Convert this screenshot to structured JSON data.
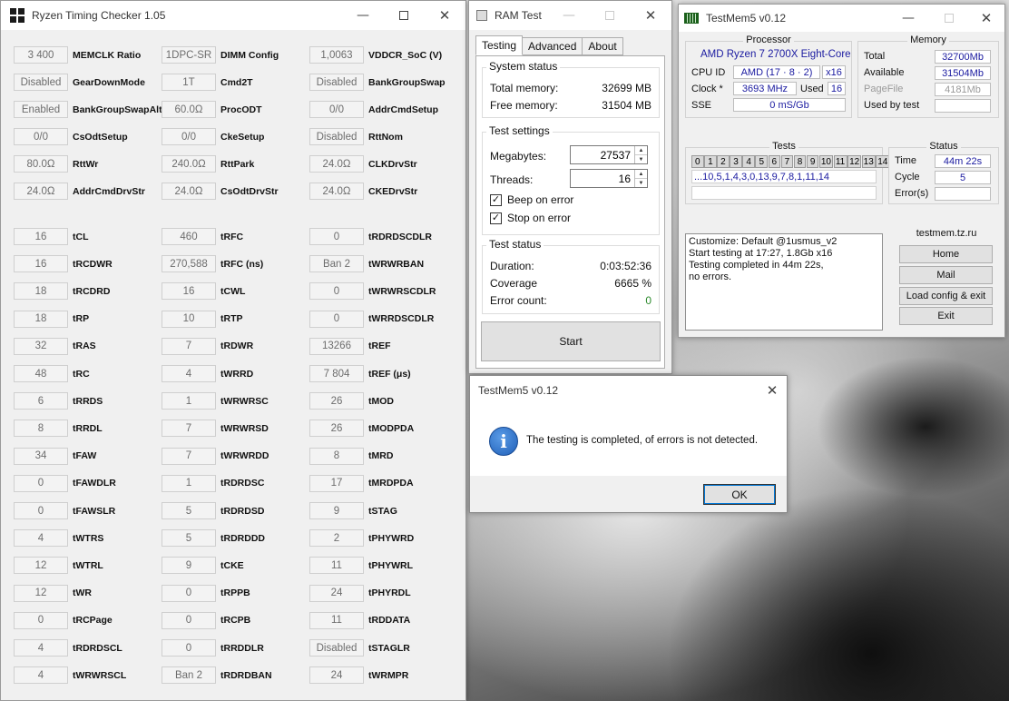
{
  "rtc": {
    "title": "Ryzen Timing Checker 1.05",
    "col1": [
      {
        "label": "MEMCLK Ratio",
        "value": "3 400"
      },
      {
        "label": "GearDownMode",
        "value": "Disabled"
      },
      {
        "label": "BankGroupSwapAlt",
        "value": "Enabled"
      },
      {
        "label": "CsOdtSetup",
        "value": "0/0"
      },
      {
        "label": "RttWr",
        "value": "80.0Ω"
      },
      {
        "label": "AddrCmdDrvStr",
        "value": "24.0Ω"
      },
      {
        "label": "tCL",
        "value": "16"
      },
      {
        "label": "tRCDWR",
        "value": "16"
      },
      {
        "label": "tRCDRD",
        "value": "18"
      },
      {
        "label": "tRP",
        "value": "18"
      },
      {
        "label": "tRAS",
        "value": "32"
      },
      {
        "label": "tRC",
        "value": "48"
      },
      {
        "label": "tRRDS",
        "value": "6"
      },
      {
        "label": "tRRDL",
        "value": "8"
      },
      {
        "label": "tFAW",
        "value": "34"
      },
      {
        "label": "tFAWDLR",
        "value": "0"
      },
      {
        "label": "tFAWSLR",
        "value": "0"
      },
      {
        "label": "tWTRS",
        "value": "4"
      },
      {
        "label": "tWTRL",
        "value": "12"
      },
      {
        "label": "tWR",
        "value": "12"
      },
      {
        "label": "tRCPage",
        "value": "0"
      },
      {
        "label": "tRDRDSCL",
        "value": "4"
      },
      {
        "label": "tWRWRSCL",
        "value": "4"
      }
    ],
    "col2": [
      {
        "label": "DIMM Config",
        "value": "1DPC-SR"
      },
      {
        "label": "Cmd2T",
        "value": "1T"
      },
      {
        "label": "ProcODT",
        "value": "60.0Ω"
      },
      {
        "label": "CkeSetup",
        "value": "0/0"
      },
      {
        "label": "RttPark",
        "value": "240.0Ω"
      },
      {
        "label": "CsOdtDrvStr",
        "value": "24.0Ω"
      },
      {
        "label": "tRFC",
        "value": "460"
      },
      {
        "label": "tRFC (ns)",
        "value": "270,588"
      },
      {
        "label": "tCWL",
        "value": "16"
      },
      {
        "label": "tRTP",
        "value": "10"
      },
      {
        "label": "tRDWR",
        "value": "7"
      },
      {
        "label": "tWRRD",
        "value": "4"
      },
      {
        "label": "tWRWRSC",
        "value": "1"
      },
      {
        "label": "tWRWRSD",
        "value": "7"
      },
      {
        "label": "tWRWRDD",
        "value": "7"
      },
      {
        "label": "tRDRDSC",
        "value": "1"
      },
      {
        "label": "tRDRDSD",
        "value": "5"
      },
      {
        "label": "tRDRDDD",
        "value": "5"
      },
      {
        "label": "tCKE",
        "value": "9"
      },
      {
        "label": "tRPPB",
        "value": "0"
      },
      {
        "label": "tRCPB",
        "value": "0"
      },
      {
        "label": "tRRDDLR",
        "value": "0"
      },
      {
        "label": "tRDRDBAN",
        "value": "Ban 2"
      }
    ],
    "col3": [
      {
        "label": "VDDCR_SoC (V)",
        "value": "1,0063"
      },
      {
        "label": "BankGroupSwap",
        "value": "Disabled"
      },
      {
        "label": "AddrCmdSetup",
        "value": "0/0"
      },
      {
        "label": "RttNom",
        "value": "Disabled"
      },
      {
        "label": "CLKDrvStr",
        "value": "24.0Ω"
      },
      {
        "label": "CKEDrvStr",
        "value": "24.0Ω"
      },
      {
        "label": "tRDRDSCDLR",
        "value": "0"
      },
      {
        "label": "tWRWRBAN",
        "value": "Ban 2"
      },
      {
        "label": "tWRWRSCDLR",
        "value": "0"
      },
      {
        "label": "tWRRDSCDLR",
        "value": "0"
      },
      {
        "label": "tREF",
        "value": "13266"
      },
      {
        "label": "tREF (μs)",
        "value": "7 804"
      },
      {
        "label": "tMOD",
        "value": "26"
      },
      {
        "label": "tMODPDA",
        "value": "26"
      },
      {
        "label": "tMRD",
        "value": "8"
      },
      {
        "label": "tMRDPDA",
        "value": "17"
      },
      {
        "label": "tSTAG",
        "value": "9"
      },
      {
        "label": "tPHYWRD",
        "value": "2"
      },
      {
        "label": "tPHYWRL",
        "value": "11"
      },
      {
        "label": "tPHYRDL",
        "value": "24"
      },
      {
        "label": "tRDDATA",
        "value": "11"
      },
      {
        "label": "tSTAGLR",
        "value": "Disabled"
      },
      {
        "label": "tWRMPR",
        "value": "24"
      }
    ]
  },
  "ram": {
    "title": "RAM Test",
    "tabs": [
      "Testing",
      "Advanced",
      "About"
    ],
    "system_status": {
      "title": "System status",
      "total_label": "Total memory:",
      "total_value": "32699 MB",
      "free_label": "Free memory:",
      "free_value": "31504 MB"
    },
    "test_settings": {
      "title": "Test settings",
      "megabytes_label": "Megabytes:",
      "megabytes_value": "27537",
      "threads_label": "Threads:",
      "threads_value": "16",
      "beep_label": "Beep on error",
      "stop_label": "Stop on error"
    },
    "test_status": {
      "title": "Test status",
      "duration_label": "Duration:",
      "duration_value": "0:03:52:36",
      "coverage_label": "Coverage",
      "coverage_value": "6665 %",
      "errors_label": "Error count:",
      "errors_value": "0",
      "errors_color": "#2e8b2e"
    },
    "start_label": "Start"
  },
  "tm": {
    "title": "TestMem5 v0.12",
    "processor": {
      "title": "Processor",
      "name": "AMD Ryzen 7 2700X Eight-Core",
      "cpuid_label": "CPU ID",
      "cpuid_value": "AMD  (17 · 8 · 2)",
      "threads_value": "x16",
      "clock_label": "Clock *",
      "clock_value": "3693 MHz",
      "used_label": "Used",
      "used_value": "16",
      "sse_label": "SSE",
      "sse_value": "0 mS/Gb"
    },
    "memory": {
      "title": "Memory",
      "total_label": "Total",
      "total_value": "32700Mb",
      "avail_label": "Available",
      "avail_value": "31504Mb",
      "pagefile_label": "PageFile",
      "pagefile_value": "4181Mb",
      "usedby_label": "Used by test",
      "usedby_value": ""
    },
    "tests": {
      "title": "Tests",
      "cells": [
        "0",
        "1",
        "2",
        "3",
        "4",
        "5",
        "6",
        "7",
        "8",
        "9",
        "10",
        "11",
        "12",
        "13",
        "14"
      ],
      "sequence": "...10,5,1,4,3,0,13,9,7,8,1,11,14"
    },
    "status": {
      "title": "Status",
      "time_label": "Time",
      "time_value": "44m 22s",
      "cycle_label": "Cycle",
      "cycle_value": "5",
      "errors_label": "Error(s)",
      "errors_value": ""
    },
    "log": [
      "Customize: Default @1usmus_v2",
      "Start testing at 17:27, 1.8Gb x16",
      "Testing completed in 44m 22s,",
      "no errors."
    ],
    "site": {
      "title": "testmem.tz.ru",
      "home": "Home",
      "mail": "Mail",
      "load": "Load config & exit",
      "exit": "Exit"
    }
  },
  "dialog": {
    "title": "TestMem5 v0.12",
    "message": "The testing is completed, of errors is not detected.",
    "ok": "OK"
  },
  "colors": {
    "value_blue": "#1a1aa0",
    "accent": "#0078d7"
  }
}
